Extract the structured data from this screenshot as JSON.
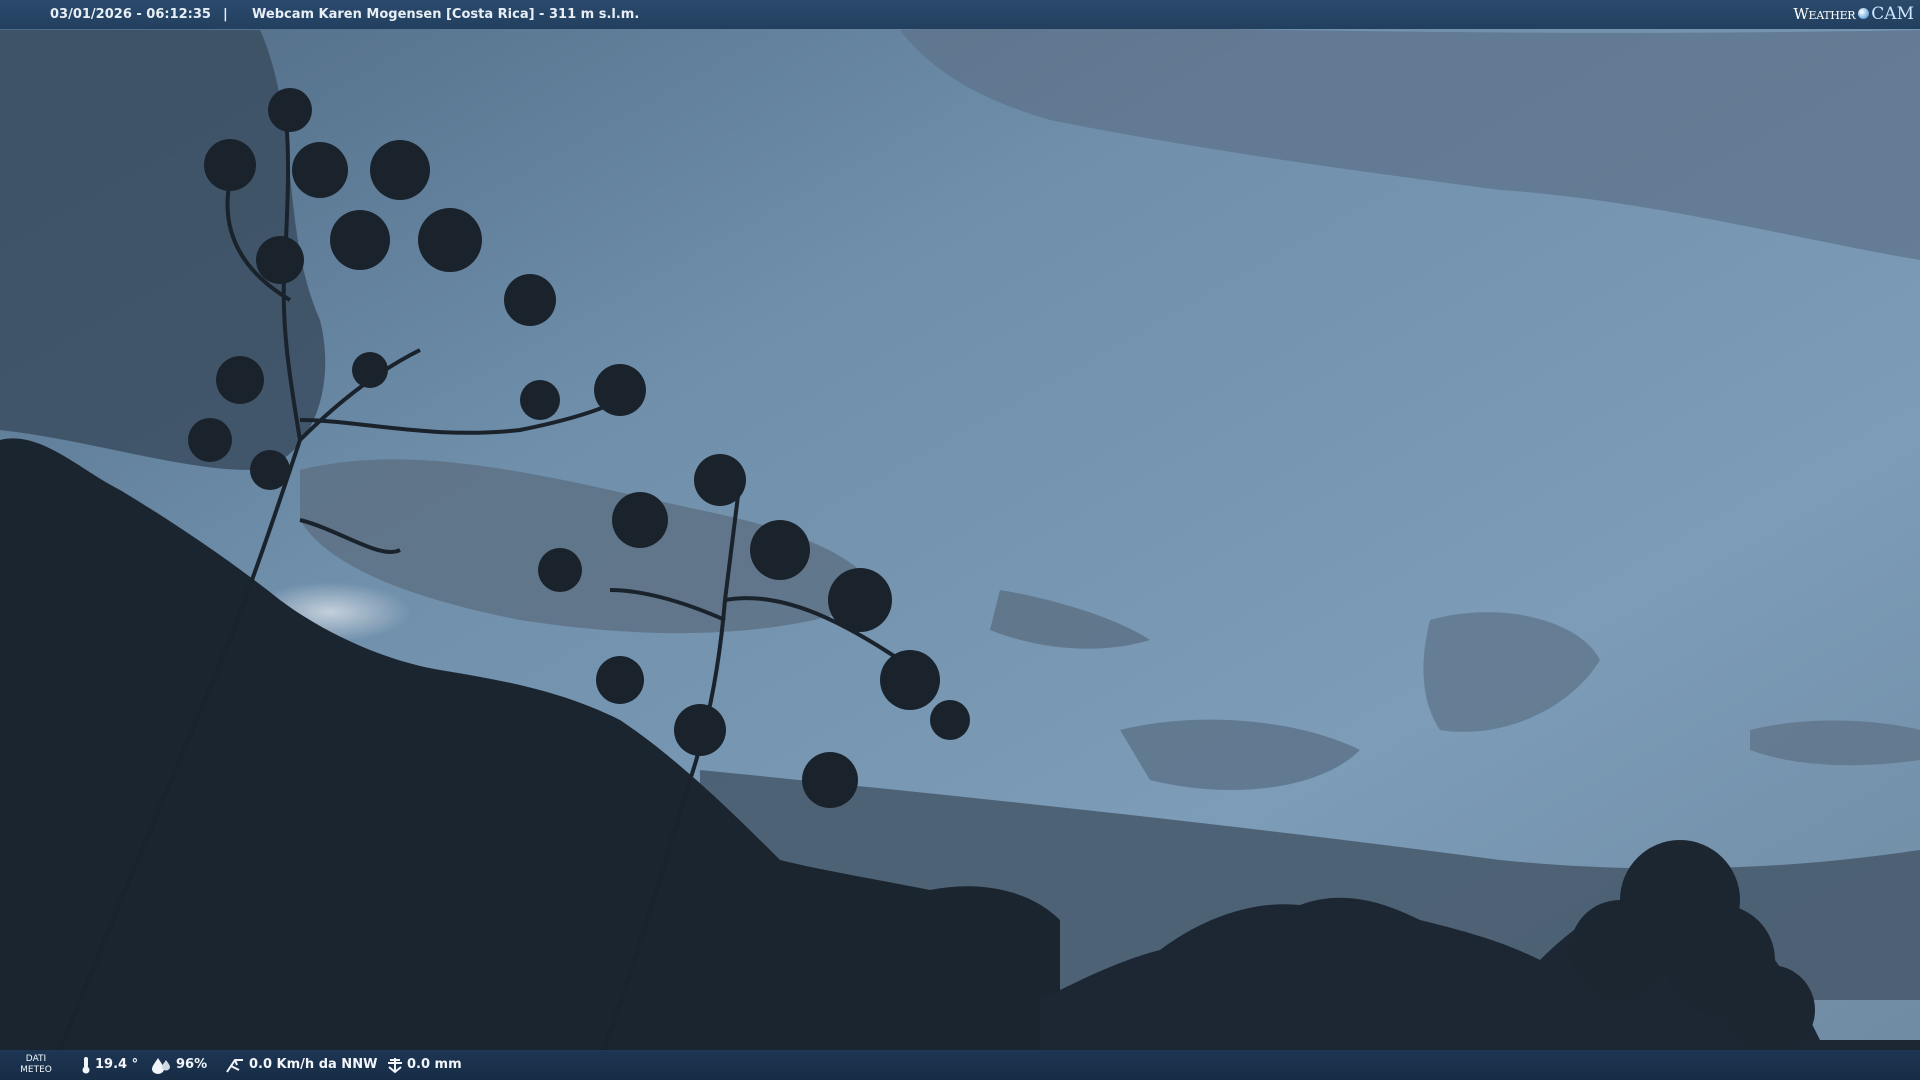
{
  "header": {
    "datetime": "03/01/2026 - 06:12:35",
    "separator": "|",
    "title": "Webcam Karen Mogensen [Costa Rica] - 311 m s.l.m.",
    "logo_word1": "Weather",
    "logo_word2": "CAM"
  },
  "footer": {
    "meteo_label_line1": "DATI",
    "meteo_label_line2": "METEO",
    "temperature": "19.4 °",
    "humidity": "96%",
    "wind": "0.0 Km/h da NNW",
    "rain": "0.0 mm",
    "icons": [
      "thermometer-icon",
      "humidity-drop-icon",
      "wind-icon",
      "rain-gauge-icon"
    ]
  },
  "colors": {
    "header_bg": "#2b4a6c",
    "footer_bg": "#1d3654",
    "bar_text": "#e8eef5"
  }
}
